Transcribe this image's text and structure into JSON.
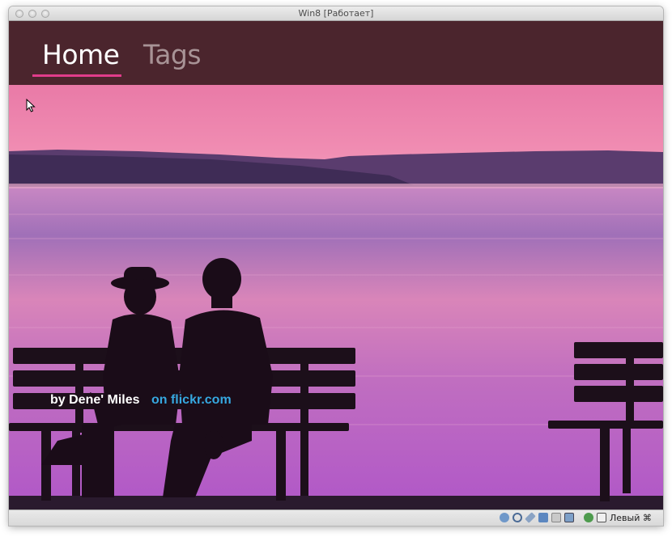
{
  "window": {
    "title": "Win8 [Работает]"
  },
  "nav": {
    "tabs": [
      {
        "label": "Home",
        "active": true
      },
      {
        "label": "Tags",
        "active": false
      }
    ],
    "accent_color": "#e03c8a",
    "bar_color": "#4b252d"
  },
  "photo": {
    "author": "by Dene' Miles",
    "source_link": "on flickr.com"
  },
  "statusbar": {
    "icons": [
      "disk-icon",
      "cd-icon",
      "usb-icon",
      "network-icon",
      "shared-folder-icon",
      "display-icon",
      "capture-icon",
      "mouse-integration-icon"
    ],
    "host_key": "Левый ⌘"
  }
}
